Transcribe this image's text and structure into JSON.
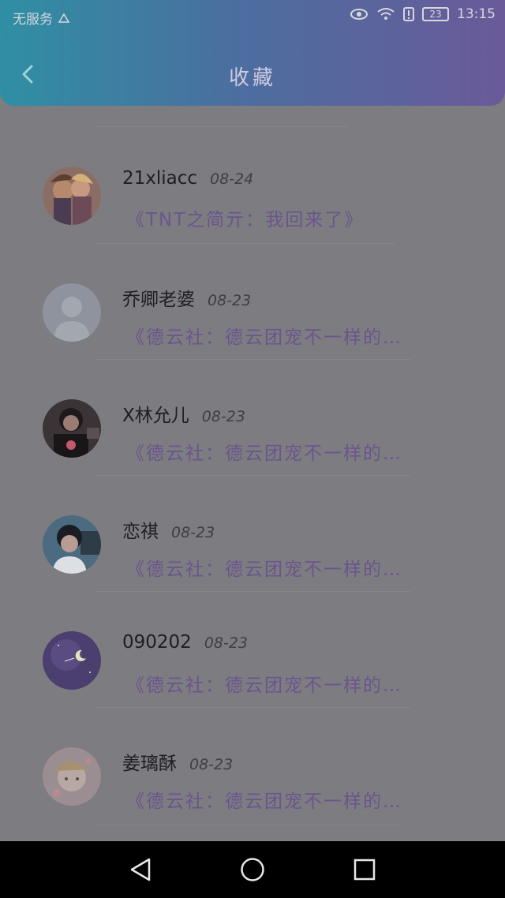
{
  "status_bar": {
    "carrier": "无服务",
    "time": "13:15",
    "battery": "23"
  },
  "header": {
    "title": "收藏"
  },
  "items": [
    {
      "name": "21xliacc",
      "date": "08-24",
      "content": "《TNT之简亓：我回来了》"
    },
    {
      "name": "乔卿老婆",
      "date": "08-23",
      "content": "《德云社：德云团宠不一样的…"
    },
    {
      "name": "X林允儿",
      "date": "08-23",
      "content": "《德云社：德云团宠不一样的…"
    },
    {
      "name": "恋祺",
      "date": "08-23",
      "content": "《德云社：德云团宠不一样的…"
    },
    {
      "name": "090202",
      "date": "08-23",
      "content": "《德云社：德云团宠不一样的…"
    },
    {
      "name": "姜璃酥",
      "date": "08-23",
      "content": "《德云社：德云团宠不一样的…"
    }
  ],
  "colors": {
    "header_start": "#2f8fa4",
    "header_end": "#6a5a9a",
    "content_text": "#6a558e",
    "background": "#7d7c80"
  },
  "icons": {
    "back": "chevron-left-icon",
    "nav_back": "triangle-back-icon",
    "nav_home": "circle-home-icon",
    "nav_recent": "square-recent-icon"
  }
}
